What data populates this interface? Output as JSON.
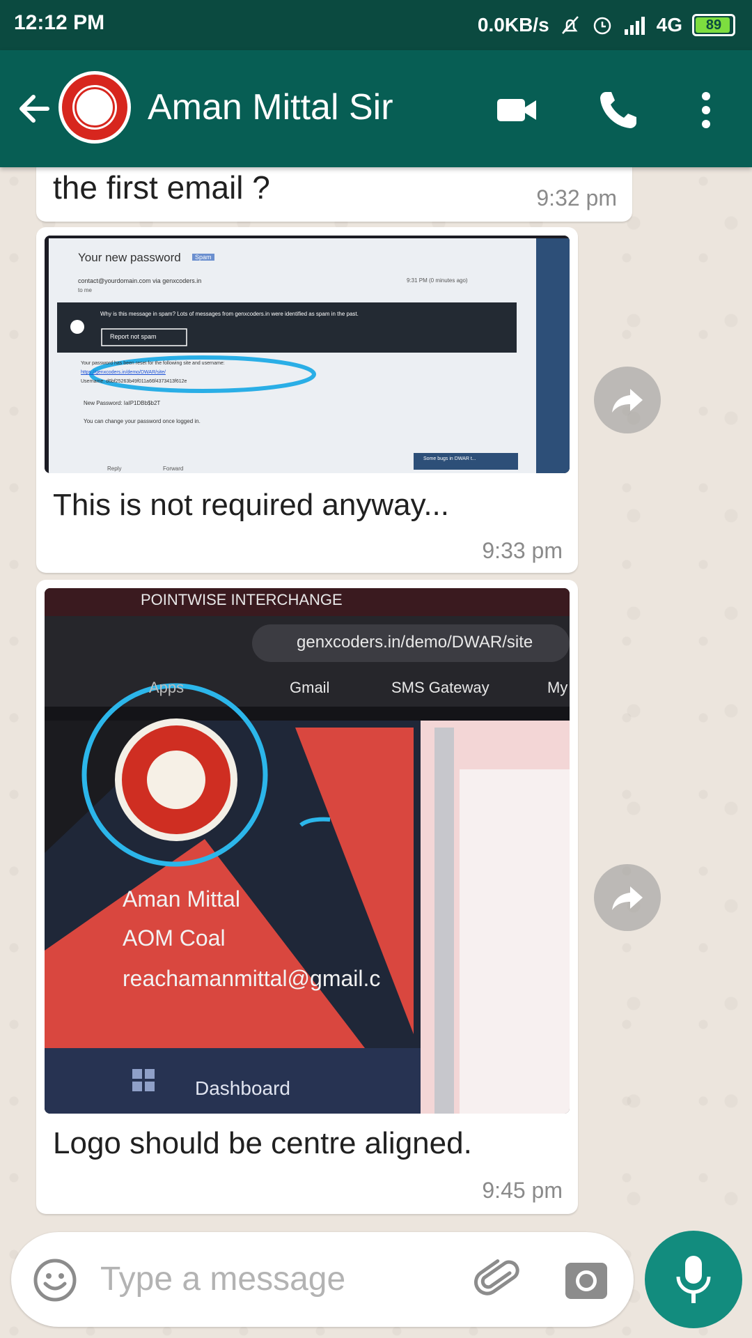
{
  "status_bar": {
    "time": "12:12 PM",
    "network_speed": "0.0KB/s",
    "network": "4G",
    "battery": "89"
  },
  "header": {
    "contact_name": "Aman Mittal Sir"
  },
  "messages": [
    {
      "text": "the first email ?",
      "time": "9:32 pm"
    },
    {
      "text": "This is not required anyway...",
      "time": "9:33 pm",
      "image": {
        "subject": "Your new password",
        "tag": "Spam",
        "from": "contact@yourdomain.com via genxcoders.in",
        "to": "to me",
        "date": "9:31 PM (0 minutes ago)",
        "spam_notice": "Why is this message in spam? Lots of messages from genxcoders.in were identified as spam in the past.",
        "report_button": "Report not spam",
        "body_line1": "Your password has been reset for the following site and username:",
        "body_link": "https://genxcoders.in/demo/DWAR/site/",
        "body_username": "Username: d6bf25263b49f011a66f4373413f612e",
        "body_password": "New Password: IaIP1DBb$b2T",
        "body_footer": "You can change your password once logged in.",
        "reply": "Reply",
        "forward": "Forward",
        "taskbar_item": "Some bugs in DWAR t..."
      }
    },
    {
      "text": "Logo should be centre aligned.",
      "time": "9:45 pm",
      "image": {
        "tab_title": "POINTWISE INTERCHANGE",
        "url": "genxcoders.in/demo/DWAR/site",
        "bookmarks": [
          "Apps",
          "Gmail",
          "SMS Gateway",
          "My"
        ],
        "profile_name": "Aman Mittal",
        "profile_role": "AOM Coal",
        "profile_email": "reachamanmittal@gmail.c",
        "nav_item": "Dashboard"
      }
    }
  ],
  "input": {
    "placeholder": "Type a message"
  },
  "colors": {
    "header": "#075e54",
    "status_bar": "#0b4a40",
    "accent": "#128c7e",
    "wallpaper": "#ece5dd"
  }
}
